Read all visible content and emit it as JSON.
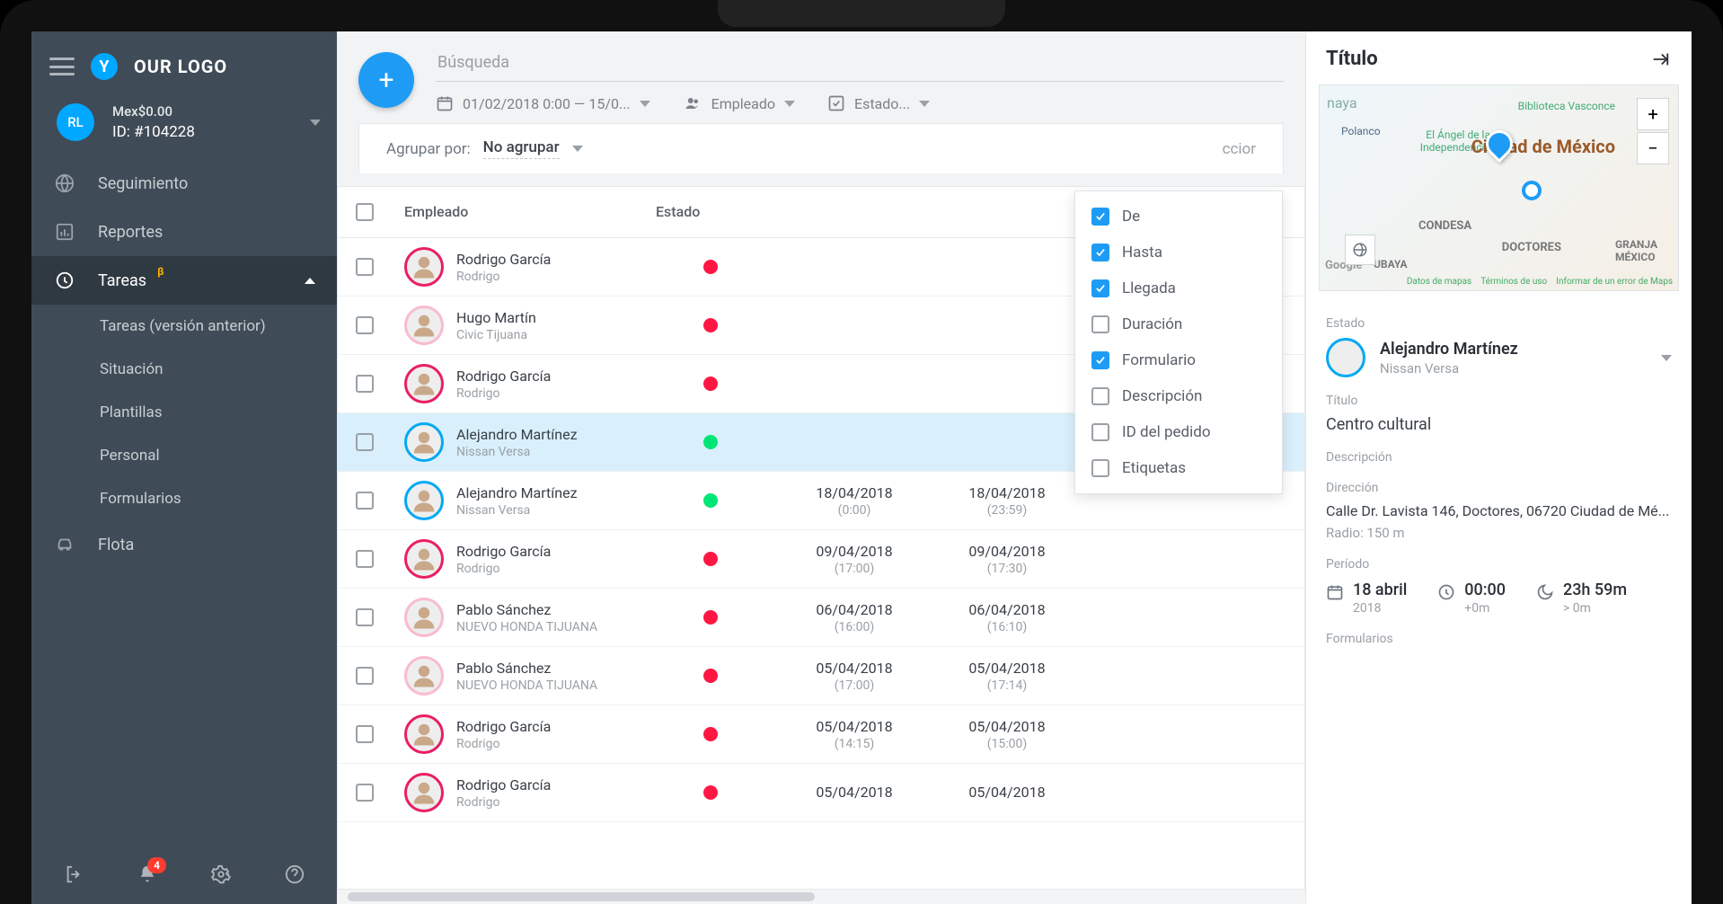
{
  "sidebar": {
    "logo_letter": "Y",
    "logo_text": "OUR LOGO",
    "user": {
      "initials": "RL",
      "balance": "Mex$0.00",
      "id_label": "ID: #104228"
    },
    "nav": {
      "seguimiento": "Seguimiento",
      "reportes": "Reportes",
      "tareas": "Tareas",
      "beta": "β",
      "tareas_old": "Tareas (versión anterior)",
      "situacion": "Situación",
      "plantillas": "Plantillas",
      "personal": "Personal",
      "formularios": "Formularios",
      "flota": "Flota"
    },
    "notif_count": "4"
  },
  "topbar": {
    "search_placeholder": "Búsqueda",
    "date_range": "01/02/2018 0:00 — 15/0...",
    "empleado_label": "Empleado",
    "estado_label": "Estado..."
  },
  "toolbar2": {
    "group_label": "Agrupar por:",
    "group_value": "No agrupar",
    "trunc": "ccior"
  },
  "thead": {
    "c1": "Empleado",
    "c2": "Estado"
  },
  "columns_dd": [
    {
      "label": "De",
      "checked": true
    },
    {
      "label": "Hasta",
      "checked": true
    },
    {
      "label": "Llegada",
      "checked": true
    },
    {
      "label": "Duración",
      "checked": false
    },
    {
      "label": "Formulario",
      "checked": true
    },
    {
      "label": "Descripción",
      "checked": false
    },
    {
      "label": "ID del pedido",
      "checked": false
    },
    {
      "label": "Etiquetas",
      "checked": false
    }
  ],
  "rows": [
    {
      "name": "Rodrigo García",
      "sub": "Rodrigo",
      "av": "pink",
      "status": "red",
      "d1": "",
      "t1": "",
      "d2": "",
      "t2": "",
      "sel": false
    },
    {
      "name": "Hugo Martín",
      "sub": "Civic Tijuana",
      "av": "lpink",
      "status": "red",
      "d1": "",
      "t1": "",
      "d2": "",
      "t2": "",
      "sel": false
    },
    {
      "name": "Rodrigo García",
      "sub": "Rodrigo",
      "av": "pink",
      "status": "red",
      "d1": "",
      "t1": "",
      "d2": "",
      "t2": "",
      "sel": false
    },
    {
      "name": "Alejandro Martínez",
      "sub": "Nissan Versa",
      "av": "blue",
      "status": "green",
      "d1": "",
      "t1": "",
      "d2": "",
      "t2": "",
      "sel": true
    },
    {
      "name": "Alejandro Martínez",
      "sub": "Nissan Versa",
      "av": "blue",
      "status": "green",
      "d1": "18/04/2018",
      "t1": "(0:00)",
      "d2": "18/04/2018",
      "t2": "(23:59)",
      "sel": false
    },
    {
      "name": "Rodrigo García",
      "sub": "Rodrigo",
      "av": "pink",
      "status": "red",
      "d1": "09/04/2018",
      "t1": "(17:00)",
      "d2": "09/04/2018",
      "t2": "(17:30)",
      "sel": false
    },
    {
      "name": "Pablo Sánchez",
      "sub": "NUEVO HONDA TIJUANA",
      "av": "lpink",
      "status": "red",
      "d1": "06/04/2018",
      "t1": "(16:00)",
      "d2": "06/04/2018",
      "t2": "(16:10)",
      "sel": false
    },
    {
      "name": "Pablo Sánchez",
      "sub": "NUEVO HONDA TIJUANA",
      "av": "lpink",
      "status": "red",
      "d1": "05/04/2018",
      "t1": "(17:00)",
      "d2": "05/04/2018",
      "t2": "(17:14)",
      "sel": false
    },
    {
      "name": "Rodrigo García",
      "sub": "Rodrigo",
      "av": "pink",
      "status": "red",
      "d1": "05/04/2018",
      "t1": "(14:15)",
      "d2": "05/04/2018",
      "t2": "(15:00)",
      "sel": false
    },
    {
      "name": "Rodrigo García",
      "sub": "Rodrigo",
      "av": "pink",
      "status": "red",
      "d1": "05/04/2018",
      "t1": "",
      "d2": "05/04/2018",
      "t2": "",
      "sel": false
    }
  ],
  "details": {
    "header": "Título",
    "map": {
      "city": "Ciudad de México",
      "l1": "Polanco",
      "l2": "El Ángel de la Independencia",
      "l3": "Biblioteca Vasconce",
      "l4": "CONDESA",
      "l5": "DOCTORES",
      "l6": "GRANJA MÉXICO",
      "l7": "UBAYA",
      "l8": "naya",
      "attr1": "Datos de mapas",
      "attr2": "Términos de uso",
      "attr3": "Informar de un error de Maps",
      "glogo": "Google"
    },
    "estado_label": "Estado",
    "assignee": {
      "name": "Alejandro Martínez",
      "sub": "Nissan Versa"
    },
    "titulo_label": "Título",
    "titulo_value": "Centro cultural",
    "descripcion_label": "Descripción",
    "direccion_label": "Dirección",
    "direccion_value": "Calle Dr. Lavista 146, Doctores, 06720 Ciudad de Mé...",
    "radio": "Radio: 150 m",
    "periodo_label": "Período",
    "period": {
      "date": "18 abril",
      "year": "2018",
      "start": "00:00",
      "start_off": "+0m",
      "dur": "23h 59m",
      "dur_off": "> 0m"
    },
    "formularios_label": "Formularios"
  }
}
